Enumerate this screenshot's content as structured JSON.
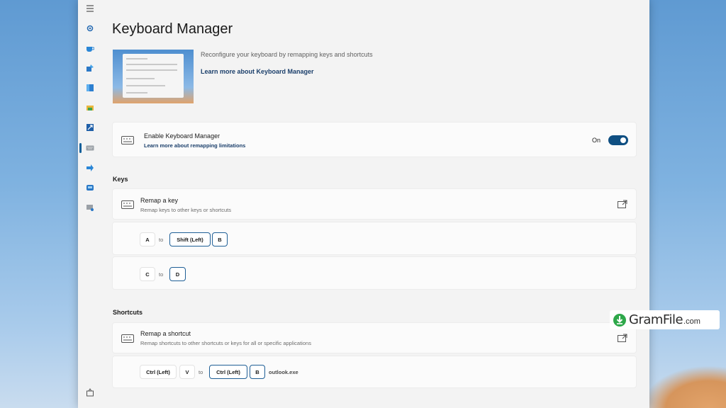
{
  "nav": {
    "items": [
      "menu-icon",
      "general-icon",
      "awake-icon",
      "color-picker-icon",
      "fancyzones-icon",
      "file-explorer-icon",
      "image-resizer-icon",
      "keyboard-manager-icon",
      "mouse-utilities-icon",
      "peek-icon",
      "quick-accent-icon"
    ],
    "footer": [
      "whats-new-icon"
    ]
  },
  "page": {
    "title": "Keyboard Manager",
    "description": "Reconfigure your keyboard by remapping keys and shortcuts",
    "learn_more": "Learn more about Keyboard Manager"
  },
  "enable_card": {
    "title": "Enable Keyboard Manager",
    "link": "Learn more about remapping limitations",
    "state_label": "On",
    "enabled": true
  },
  "keys": {
    "header": "Keys",
    "remap_title": "Remap a key",
    "remap_sub": "Remap keys to other keys or shortcuts",
    "mappings": [
      {
        "from": [
          "A"
        ],
        "to_word": "to",
        "target": [
          "Shift (Left)",
          "B"
        ]
      },
      {
        "from": [
          "C"
        ],
        "to_word": "to",
        "target": [
          "D"
        ]
      }
    ]
  },
  "shortcuts": {
    "header": "Shortcuts",
    "remap_title": "Remap a shortcut",
    "remap_sub": "Remap shortcuts to other shortcuts or keys for all or specific applications",
    "mappings": [
      {
        "from": [
          "Ctrl (Left)",
          "V"
        ],
        "to_word": "to",
        "target": [
          "Ctrl (Left)",
          "B"
        ],
        "app": "outlook.exe"
      }
    ]
  },
  "watermark": {
    "brand": "GramFile",
    "tld": ".com"
  },
  "colors": {
    "accent": "#0f4f82",
    "link": "#1b3f6b"
  }
}
